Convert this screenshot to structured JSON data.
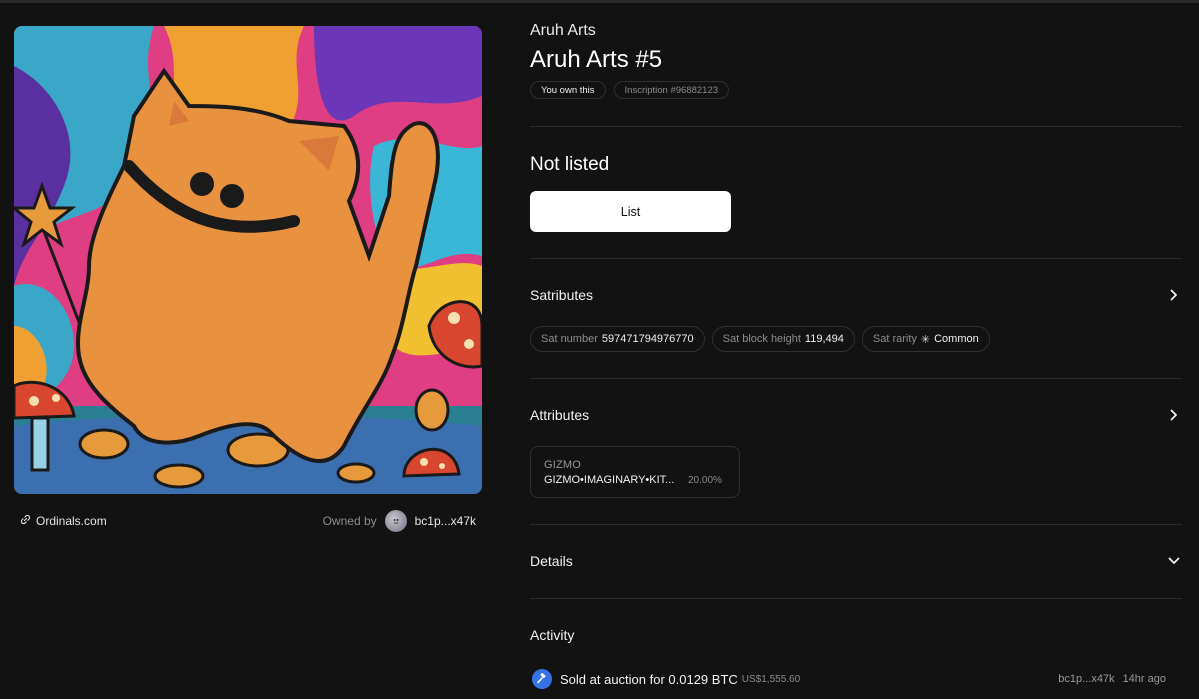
{
  "nft": {
    "collection": "Aruh Arts",
    "title": "Aruh Arts #5",
    "ownership_badge": "You own this",
    "inscription_badge": "Inscription #96882123"
  },
  "left": {
    "source_link": "Ordinals.com",
    "owned_by_label": "Owned by",
    "owner_address": "bc1p...x47k"
  },
  "listing": {
    "status": "Not listed",
    "list_button": "List"
  },
  "satributes": {
    "title": "Satributes",
    "chips": [
      {
        "key": "Sat number",
        "value": "597471794976770"
      },
      {
        "key": "Sat block height",
        "value": "119,494"
      },
      {
        "key": "Sat rarity",
        "icon": "✳",
        "value": "Common"
      }
    ]
  },
  "attributes": {
    "title": "Attributes",
    "items": [
      {
        "type": "GIZMO",
        "value": "GIZMO•IMAGINARY•KIT...",
        "percent": "20.00%"
      }
    ]
  },
  "details": {
    "title": "Details"
  },
  "activity": {
    "title": "Activity",
    "events": [
      {
        "text": "Sold at auction for 0.0129 BTC",
        "usd": "US$1,555.60",
        "address": "bc1p...x47k",
        "time": "14hr ago"
      }
    ]
  },
  "colors": {
    "background": "#121212",
    "accent_blue": "#3572e6",
    "artwork_cat": "#e8913f"
  },
  "icons": [
    "link-icon",
    "chevron-right-icon",
    "chevron-down-icon",
    "hammer-icon",
    "sparkle-icon"
  ]
}
